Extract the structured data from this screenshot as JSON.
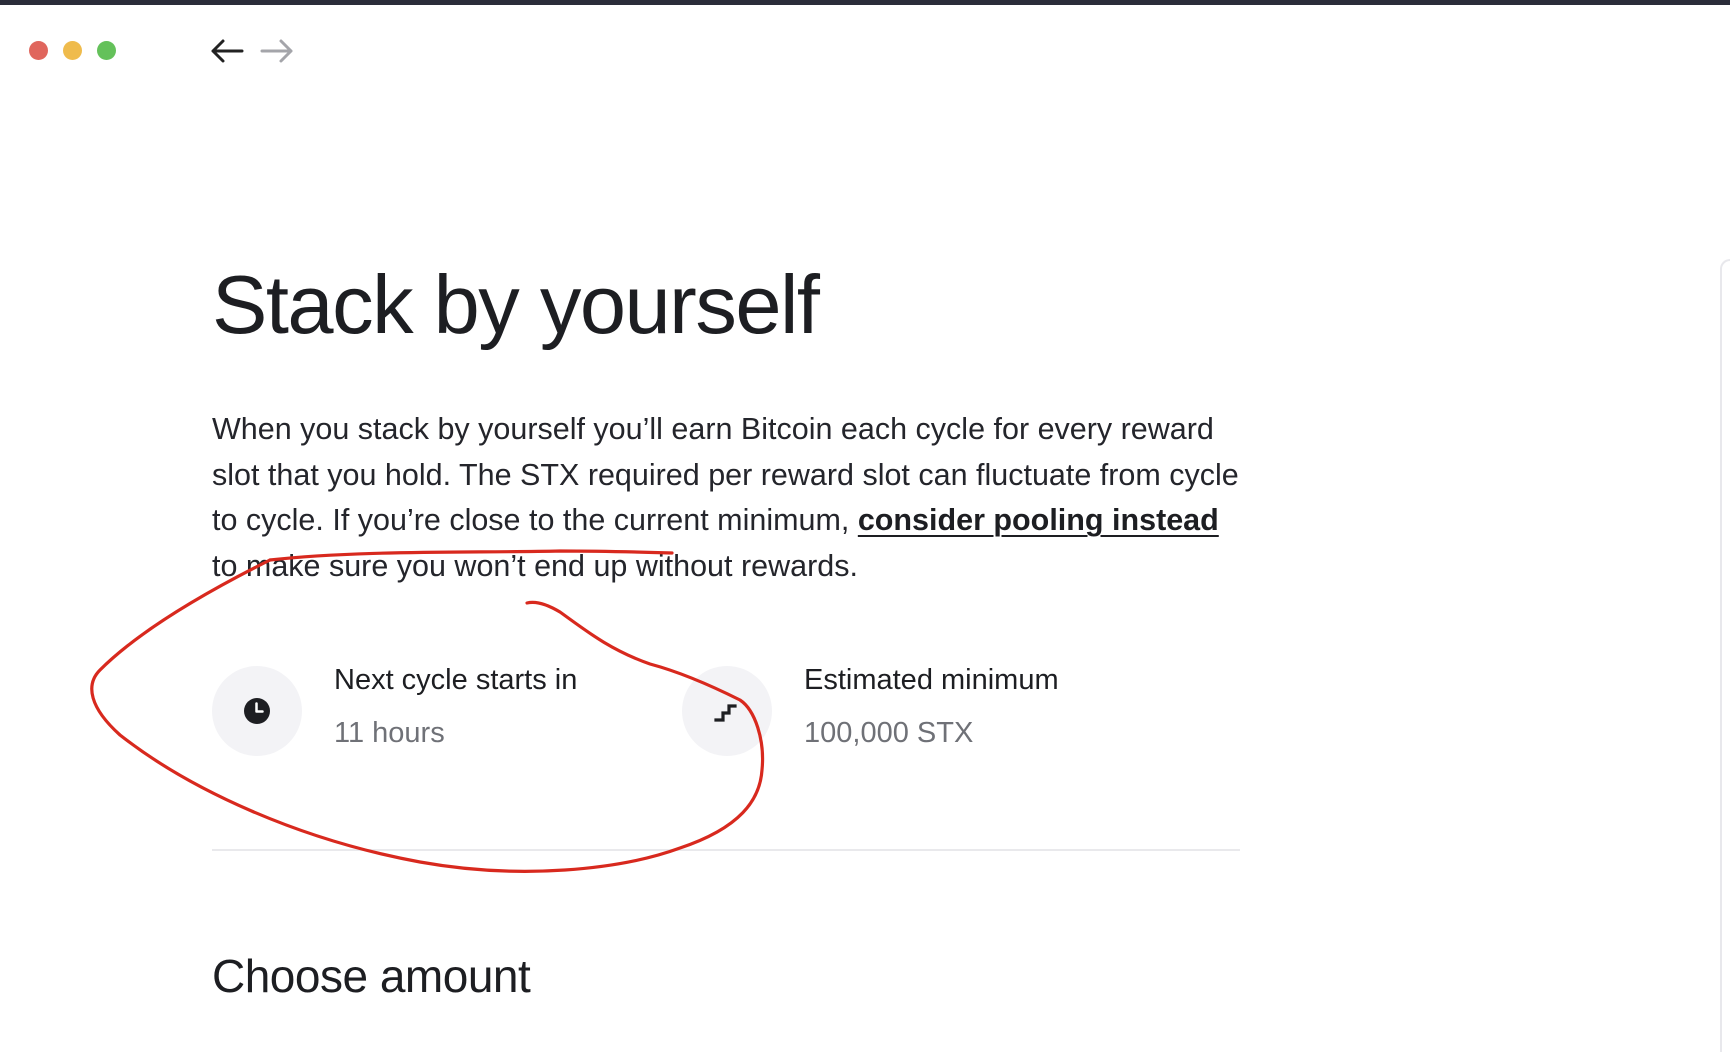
{
  "window": {
    "controls": [
      "close",
      "minimize",
      "maximize"
    ],
    "nav": {
      "back_icon": "arrow-left-icon",
      "forward_icon": "arrow-right-icon"
    }
  },
  "page": {
    "title": "Stack by yourself",
    "description_part1": "When you stack by yourself you’ll earn Bitcoin each cycle for every reward slot that you hold. The STX required per reward slot can fluctuate from cycle to cycle. If you’re close to the current minimum, ",
    "description_link": "consider pooling instead",
    "description_part2": " to make sure you won’t end up without rewards.",
    "stats": [
      {
        "icon": "clock-icon",
        "label": "Next cycle starts in",
        "value": "11 hours"
      },
      {
        "icon": "stairs-icon",
        "label": "Estimated minimum",
        "value": "100,000 STX"
      }
    ],
    "section_title": "Choose amount"
  },
  "colors": {
    "annotation": "#d8291e",
    "traffic_red": "#e0665d",
    "traffic_yellow": "#efbb4c",
    "traffic_green": "#64c15a"
  }
}
